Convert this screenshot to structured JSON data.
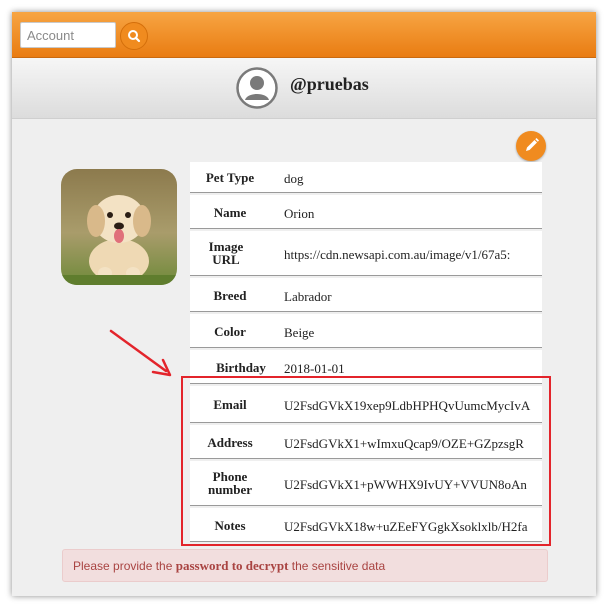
{
  "search": {
    "placeholder": "Account"
  },
  "profile": {
    "username": "@pruebas"
  },
  "pet": {
    "rows": [
      {
        "label": "Pet Type",
        "value": "dog"
      },
      {
        "label": "Name",
        "value": "Orion"
      },
      {
        "label": "Image URL",
        "value": "https://cdn.newsapi.com.au/image/v1/67a5:"
      },
      {
        "label": "Breed",
        "value": "Labrador"
      },
      {
        "label": "Color",
        "value": "Beige"
      },
      {
        "label": "Birthday",
        "value": "2018-01-01"
      },
      {
        "label": "Email",
        "value": "U2FsdGVkX19xep9LdbHPHQvUumcMycIvA"
      },
      {
        "label": "Address",
        "value": "U2FsdGVkX1+wImxuQcap9/OZE+GZpzsgR"
      },
      {
        "label": "Phone number",
        "value": "U2FsdGVkX1+pWWHX9IvUY+VVUN8oAn"
      },
      {
        "label": "Notes",
        "value": "U2FsdGVkX18w+uZEeFYGgkXsoklxlb/H2fa"
      }
    ]
  },
  "alert": {
    "prefix": "Please provide the ",
    "emphasis": "password to decrypt",
    "suffix": " the sensitive data"
  },
  "colors": {
    "accent": "#f08b1f",
    "highlight": "#e3242b"
  }
}
